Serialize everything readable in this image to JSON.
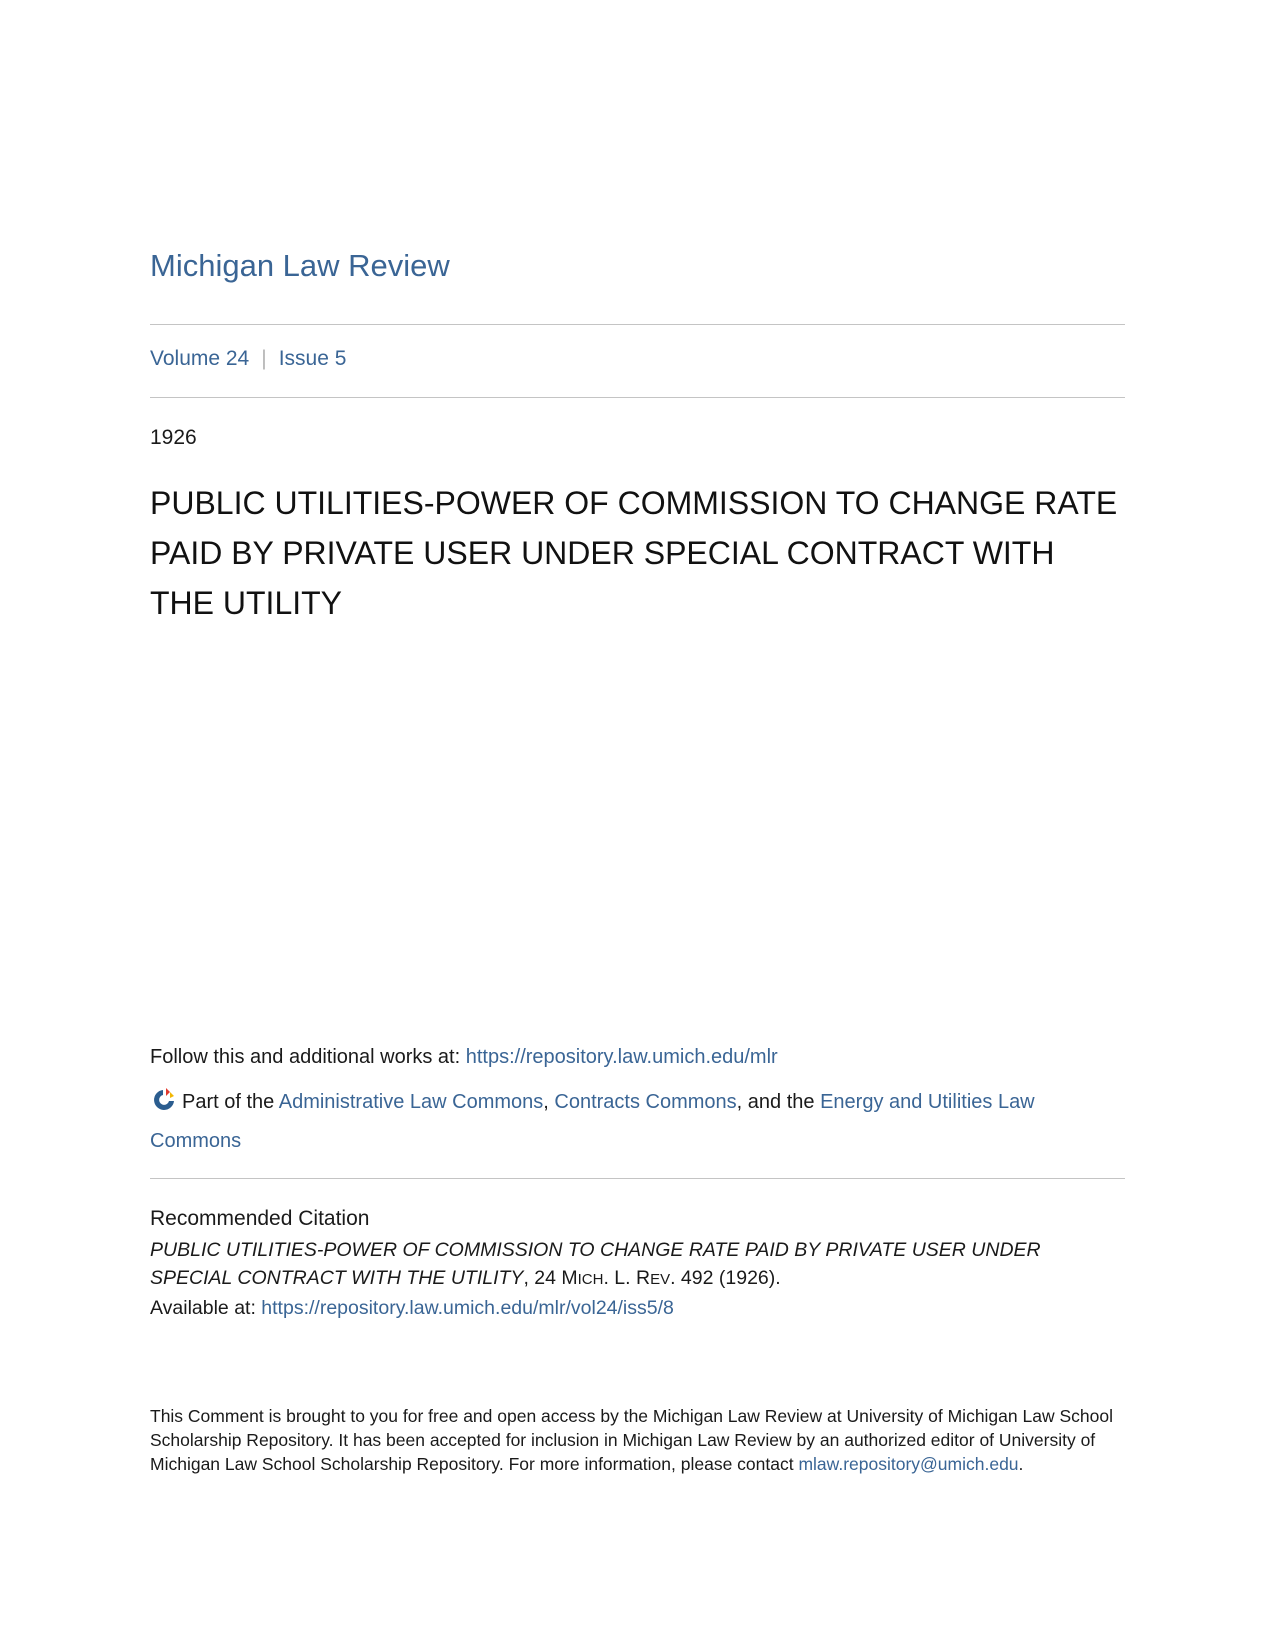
{
  "journal": {
    "title": "Michigan Law Review"
  },
  "issue": {
    "volume": "Volume 24",
    "separator": "|",
    "issue": "Issue 5"
  },
  "year": "1926",
  "article": {
    "title": "PUBLIC UTILITIES-POWER OF COMMISSION TO CHANGE RATE PAID BY PRIVATE USER UNDER SPECIAL CONTRACT WITH THE UTILITY"
  },
  "follow": {
    "prefix": "Follow this and additional works at: ",
    "url": "https://repository.law.umich.edu/mlr"
  },
  "part_of": {
    "prefix": "Part of the ",
    "link1": "Administrative Law Commons",
    "sep1": ", ",
    "link2": "Contracts Commons",
    "sep2": ", and the ",
    "link3": "Energy and Utilities Law Commons"
  },
  "citation": {
    "heading": "Recommended Citation",
    "title_italic": "PUBLIC UTILITIES-POWER OF COMMISSION TO CHANGE RATE PAID BY PRIVATE USER UNDER SPECIAL CONTRACT WITH THE UTILITY",
    "cite_prefix": ", 24 M",
    "cite_sc1": "ICH",
    "cite_mid": ". L. R",
    "cite_sc2": "EV",
    "cite_suffix": ". 492 (1926).",
    "available_prefix": "Available at: ",
    "available_url": "https://repository.law.umich.edu/mlr/vol24/iss5/8"
  },
  "footer": {
    "text": "This Comment is brought to you for free and open access by the Michigan Law Review at University of Michigan Law School Scholarship Repository. It has been accepted for inclusion in Michigan Law Review by an authorized editor of University of Michigan Law School Scholarship Repository. For more information, please contact ",
    "email": "mlaw.repository@umich.edu",
    "end": "."
  }
}
